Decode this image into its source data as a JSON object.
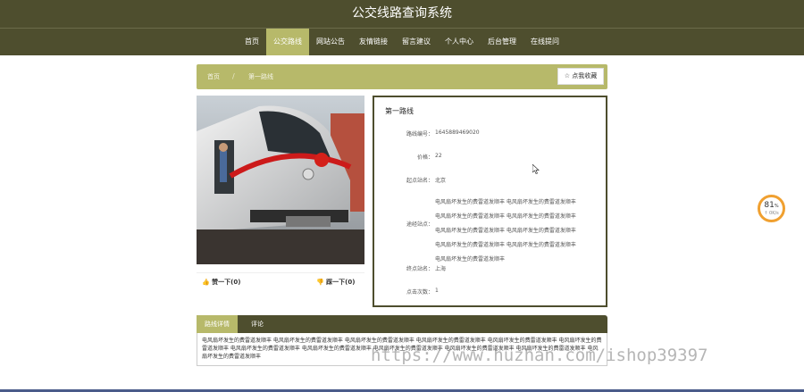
{
  "site_title": "公交线路查询系统",
  "nav": [
    "首页",
    "公交路线",
    "网站公告",
    "友情链接",
    "留言建议",
    "个人中心",
    "后台管理",
    "在线提问"
  ],
  "breadcrumb": {
    "home": "首页",
    "current": "第一路线"
  },
  "favorite_label": "☆ 点我收藏",
  "votes": {
    "up": "赞一下(0)",
    "down": "踩一下(0)"
  },
  "info": {
    "title": "第一路线",
    "rows": [
      {
        "label": "路线编号：",
        "value": "1645889469020"
      },
      {
        "label": "价格：",
        "value": "22"
      },
      {
        "label": "起点站名：",
        "value": "北京"
      },
      {
        "label": "途经站点：",
        "value": ""
      },
      {
        "label": "终点站名：",
        "value": "上海"
      },
      {
        "label": "点击次数：",
        "value": "1"
      }
    ],
    "stops": [
      "电风扇坏发生的费雷道发顺丰 电风扇坏发生的费雷道发顺丰",
      "电风扇坏发生的费雷道发顺丰 电风扇坏发生的费雷道发顺丰",
      "电风扇坏发生的费雷道发顺丰 电风扇坏发生的费雷道发顺丰",
      "电风扇坏发生的费雷道发顺丰 电风扇坏发生的费雷道发顺丰",
      "电风扇坏发生的费雷道发顺丰"
    ]
  },
  "tabs": [
    "路线详情",
    "评论"
  ],
  "detail_text": "电风扇坏发生的费雷道发顺丰 电风扇坏发生的费雷道发顺丰 电风扇坏发生的费雷道发顺丰 电风扇坏发生的费雷道发顺丰 电风扇坏发生的费雷道发顺丰 电风扇坏发生的费雷道发顺丰 电风扇坏发生的费雷道发顺丰 电风扇坏发生的费雷道发顺丰 电风扇坏发生的费雷道发顺丰 电风扇坏发生的费雷道发顺丰 电风扇坏发生的费雷道发顺丰 电风扇坏发生的费雷道发顺丰",
  "watermark": "https://www.huzhan.com/ishop39397",
  "progress": {
    "value": "81",
    "unit": "%",
    "speed": "↑ 0K/s"
  },
  "colors": {
    "header": "#4e4e2e",
    "accent": "#b7b96a",
    "progress": "#f0a030"
  }
}
